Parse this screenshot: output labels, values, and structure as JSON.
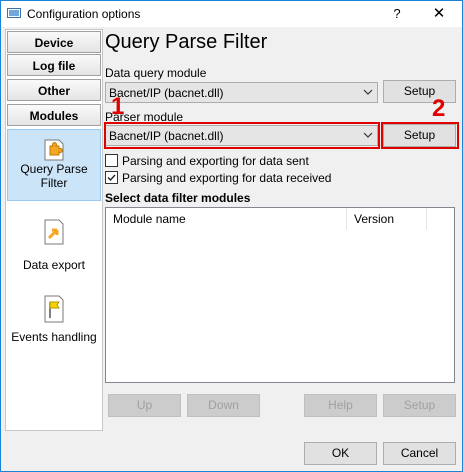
{
  "window": {
    "title": "Configuration options",
    "help_glyph": "?",
    "close_glyph": "✕"
  },
  "sidebar": {
    "groups": [
      {
        "label": "Device"
      },
      {
        "label": "Log file"
      },
      {
        "label": "Other"
      },
      {
        "label": "Modules"
      }
    ],
    "items": [
      {
        "label_line1": "Query Parse",
        "label_line2": "Filter",
        "icon": "puzzle-icon",
        "active": true
      },
      {
        "label_line1": "Data export",
        "label_line2": "",
        "icon": "export-icon",
        "active": false
      },
      {
        "label_line1": "Events handling",
        "label_line2": "",
        "icon": "flag-icon",
        "active": false
      }
    ]
  },
  "main": {
    "title": "Query Parse Filter",
    "data_query": {
      "label": "Data query module",
      "value": "Bacnet/IP (bacnet.dll)",
      "setup_label": "Setup"
    },
    "parser": {
      "label": "Parser module",
      "value": "Bacnet/IP (bacnet.dll)",
      "setup_label": "Setup"
    },
    "checkboxes": [
      {
        "label": "Parsing and exporting for data sent",
        "checked": false
      },
      {
        "label": "Parsing and exporting for data received",
        "checked": true
      }
    ],
    "filter_section_label": "Select data filter modules",
    "columns": [
      "Module name",
      "Version"
    ],
    "buttons": {
      "up": "Up",
      "down": "Down",
      "help": "Help",
      "setup": "Setup"
    }
  },
  "footer": {
    "ok": "OK",
    "cancel": "Cancel"
  },
  "annotations": {
    "marker1": "1",
    "marker2": "2",
    "color": "#e00000"
  },
  "colors": {
    "accent": "#1883d7",
    "selected_bg": "#cce4f7",
    "check_green": "#2e7d32",
    "icon_orange": "#f5a623"
  }
}
